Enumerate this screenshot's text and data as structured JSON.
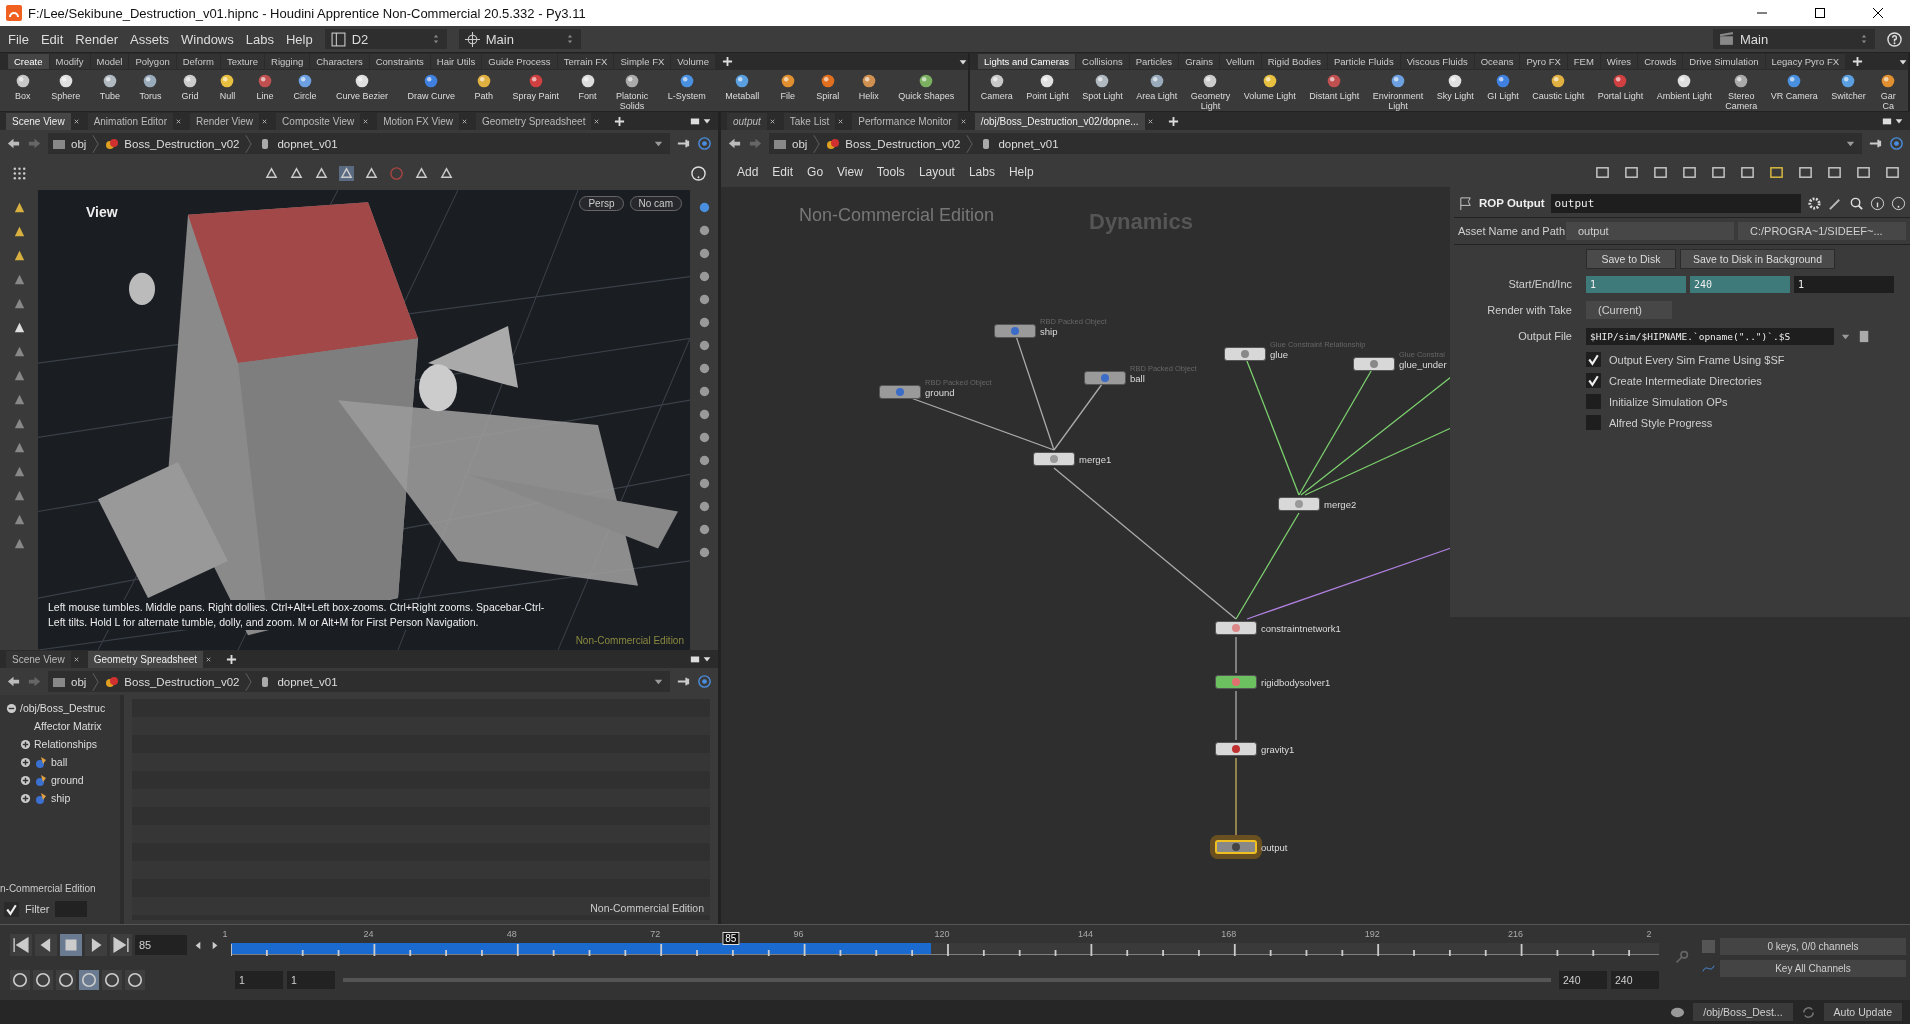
{
  "window": {
    "title": "F:/Lee/Sekibune_Destruction_v01.hipnc - Houdini Apprentice Non-Commercial 20.5.332 - Py3.11"
  },
  "menu": [
    "File",
    "Edit",
    "Render",
    "Assets",
    "Windows",
    "Labs",
    "Help"
  ],
  "desktop": "D2",
  "layout_left": "Main",
  "layout_right": "Main",
  "shelf_left": {
    "tabs": [
      {
        "label": "Create",
        "selected": true
      },
      {
        "label": "Modify",
        "selected": false
      },
      {
        "label": "Model",
        "selected": false
      },
      {
        "label": "Polygon",
        "selected": false
      },
      {
        "label": "Deform",
        "selected": false
      },
      {
        "label": "Texture",
        "selected": false
      },
      {
        "label": "Rigging",
        "selected": false
      },
      {
        "label": "Characters",
        "selected": false
      },
      {
        "label": "Constraints",
        "selected": false
      },
      {
        "label": "Hair Utils",
        "selected": false
      },
      {
        "label": "Guide Process",
        "selected": false
      },
      {
        "label": "Terrain FX",
        "selected": false
      },
      {
        "label": "Simple FX",
        "selected": false
      },
      {
        "label": "Volume",
        "selected": false
      }
    ],
    "tools": [
      "Box",
      "Sphere",
      "Tube",
      "Torus",
      "Grid",
      "Null",
      "Line",
      "Circle",
      "Curve Bezier",
      "Draw Curve",
      "Path",
      "Spray Paint",
      "Font",
      "Platonic\nSolids",
      "L-System",
      "Metaball",
      "File",
      "Spiral",
      "Helix",
      "Quick Shapes"
    ]
  },
  "shelf_right": {
    "tabs": [
      {
        "label": "Lights and Cameras",
        "selected": true
      },
      {
        "label": "Collisions",
        "selected": false
      },
      {
        "label": "Particles",
        "selected": false
      },
      {
        "label": "Grains",
        "selected": false
      },
      {
        "label": "Vellum",
        "selected": false
      },
      {
        "label": "Rigid Bodies",
        "selected": false
      },
      {
        "label": "Particle Fluids",
        "selected": false
      },
      {
        "label": "Viscous Fluids",
        "selected": false
      },
      {
        "label": "Oceans",
        "selected": false
      },
      {
        "label": "Pyro FX",
        "selected": false
      },
      {
        "label": "FEM",
        "selected": false
      },
      {
        "label": "Wires",
        "selected": false
      },
      {
        "label": "Crowds",
        "selected": false
      },
      {
        "label": "Drive Simulation",
        "selected": false
      },
      {
        "label": "Legacy Pyro FX",
        "selected": false
      }
    ],
    "tools": [
      "Camera",
      "Point Light",
      "Spot Light",
      "Area Light",
      "Geometry\nLight",
      "Volume Light",
      "Distant Light",
      "Environment\nLight",
      "Sky Light",
      "GI Light",
      "Caustic Light",
      "Portal Light",
      "Ambient Light",
      "Stereo\nCamera",
      "VR Camera",
      "Switcher",
      "Gar\nCa"
    ]
  },
  "scene_pane": {
    "tabs": [
      {
        "label": "Scene View",
        "selected": true
      },
      {
        "label": "Animation Editor",
        "selected": false
      },
      {
        "label": "Render View",
        "selected": false
      },
      {
        "label": "Composite View",
        "selected": false
      },
      {
        "label": "Motion FX View",
        "selected": false
      },
      {
        "label": "Geometry Spreadsheet",
        "selected": false
      }
    ],
    "path": [
      "obj",
      "Boss_Destruction_v02",
      "dopnet_v01"
    ],
    "viewport": {
      "label": "View",
      "menus": [
        "Persp",
        "No cam"
      ],
      "hint": "Left mouse tumbles. Middle pans. Right dollies. Ctrl+Alt+Left box-zooms. Ctrl+Right zooms. Spacebar-Ctrl-Left tilts. Hold L for alternate tumble, dolly, and zoom. M or Alt+M for First Person Navigation.",
      "watermark": "Non-Commercial Edition"
    }
  },
  "spreadsheet_pane": {
    "tabs": [
      {
        "label": "Scene View",
        "selected": false
      },
      {
        "label": "Geometry Spreadsheet",
        "selected": true
      }
    ],
    "path": [
      "obj",
      "Boss_Destruction_v02",
      "dopnet_v01"
    ],
    "tree": [
      {
        "label": "/obj/Boss_Destruc",
        "expanded": true,
        "children": [
          {
            "label": "Affector Matrix"
          },
          {
            "label": "Relationships",
            "expanded": false
          },
          {
            "label": "ball",
            "kind": "object",
            "expanded": false
          },
          {
            "label": "ground",
            "kind": "object",
            "expanded": false
          },
          {
            "label": "ship",
            "kind": "object",
            "expanded": false
          }
        ]
      }
    ],
    "tree_watermark": "n-Commercial Edition",
    "watermark": "Non-Commercial Edition",
    "filter": {
      "label": "Filter",
      "checked": true
    }
  },
  "network_pane": {
    "tabs": [
      {
        "label": "output",
        "selected": false
      },
      {
        "label": "Take List",
        "selected": false
      },
      {
        "label": "Performance Monitor",
        "selected": false
      },
      {
        "label": "/obj/Boss_Destruction_v02/dopne...",
        "selected": true
      }
    ],
    "path": [
      "obj",
      "Boss_Destruction_v02",
      "dopnet_v01"
    ],
    "menu": [
      "Add",
      "Edit",
      "Go",
      "View",
      "Tools",
      "Layout",
      "Labs",
      "Help"
    ],
    "watermark": "Non-Commercial Edition",
    "context": "Dynamics",
    "nodes": [
      {
        "name": "ship",
        "type": "RBD Packed Object",
        "kind": "object",
        "selected": false
      },
      {
        "name": "ground",
        "type": "RBD Packed Object",
        "kind": "object",
        "selected": false
      },
      {
        "name": "ball",
        "type": "RBD Packed Object",
        "kind": "object",
        "selected": false
      },
      {
        "name": "merge1",
        "kind": "merge",
        "selected": false
      },
      {
        "name": "glue",
        "type": "Glue Constraint Relationship",
        "kind": "glue",
        "selected": false
      },
      {
        "name": "glue_under",
        "type": "Glue Constrai",
        "kind": "glue",
        "selected": false
      },
      {
        "name": "merge2",
        "kind": "merge",
        "selected": false
      },
      {
        "name": "constraintnetwork1",
        "kind": "constraint",
        "selected": false
      },
      {
        "name": "rigidbodysolver1",
        "kind": "solver",
        "selected": false
      },
      {
        "name": "gravity1",
        "kind": "gravity",
        "selected": false
      },
      {
        "name": "output",
        "kind": "output",
        "selected": true
      }
    ]
  },
  "parameters": {
    "node_type": "ROP Output",
    "node_name": "output",
    "asset_label": "Asset Name and Path",
    "asset_name": "output",
    "asset_path": "C:/PROGRA~1/SIDEEF~...",
    "buttons": [
      "Save to Disk",
      "Save to Disk in Background"
    ],
    "rows": [
      {
        "label": "Start/End/Inc",
        "kind": "numbers",
        "values": [
          {
            "value": "1",
            "linked": true
          },
          {
            "value": "240",
            "linked": true
          },
          {
            "value": "1",
            "linked": false
          }
        ]
      },
      {
        "label": "Render with Take",
        "kind": "menu",
        "value": "(Current)"
      },
      {
        "label": "Output File",
        "kind": "file",
        "value": "$HIP/sim/$HIPNAME.`opname(\"..\")`.$S"
      }
    ],
    "toggles": [
      {
        "label": "Output Every Sim Frame Using $SF",
        "checked": true
      },
      {
        "label": "Create Intermediate Directories",
        "checked": true
      },
      {
        "label": "Initialize Simulation OPs",
        "checked": false
      },
      {
        "label": "Alfred Style Progress",
        "checked": false
      }
    ]
  },
  "timeline": {
    "frame": "85",
    "ticks": [
      "1",
      "24",
      "48",
      "72",
      "96",
      "120",
      "144",
      "168",
      "192",
      "216",
      "2"
    ],
    "playhead": {
      "label": "85",
      "level": 0.35
    },
    "cache": {
      "level": 0.49
    },
    "range_start": [
      "1",
      "1"
    ],
    "range_end": [
      "240",
      "240"
    ],
    "keys": "0 keys, 0/0 channels",
    "key_all": "Key All Channels"
  },
  "status_bar": {
    "path": "/obj/Boss_Dest...",
    "update": "Auto Update"
  }
}
